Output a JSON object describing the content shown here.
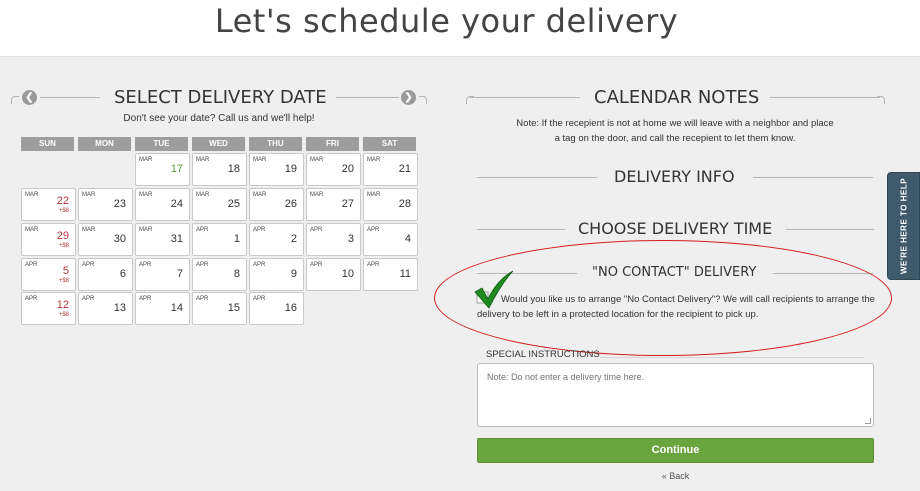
{
  "title": "Let's schedule your delivery",
  "left": {
    "heading": "SELECT DELIVERY DATE",
    "help": "Don't see your date? Call us and we'll help!",
    "prev_icon": "chevron-left-icon",
    "next_icon": "chevron-right-icon",
    "days_of_week": [
      "SUN",
      "MON",
      "TUE",
      "WED",
      "THU",
      "FRI",
      "SAT"
    ],
    "weeks": [
      [
        null,
        null,
        {
          "month": "MAR",
          "day": "17",
          "today": true
        },
        {
          "month": "MAR",
          "day": "18"
        },
        {
          "month": "MAR",
          "day": "19"
        },
        {
          "month": "MAR",
          "day": "20"
        },
        {
          "month": "MAR",
          "day": "21"
        }
      ],
      [
        {
          "month": "MAR",
          "day": "22",
          "fee": "+$8"
        },
        {
          "month": "MAR",
          "day": "23"
        },
        {
          "month": "MAR",
          "day": "24"
        },
        {
          "month": "MAR",
          "day": "25"
        },
        {
          "month": "MAR",
          "day": "26"
        },
        {
          "month": "MAR",
          "day": "27"
        },
        {
          "month": "MAR",
          "day": "28"
        }
      ],
      [
        {
          "month": "MAR",
          "day": "29",
          "fee": "+$8"
        },
        {
          "month": "MAR",
          "day": "30"
        },
        {
          "month": "MAR",
          "day": "31"
        },
        {
          "month": "APR",
          "day": "1"
        },
        {
          "month": "APR",
          "day": "2"
        },
        {
          "month": "APR",
          "day": "3"
        },
        {
          "month": "APR",
          "day": "4"
        }
      ],
      [
        {
          "month": "APR",
          "day": "5",
          "fee": "+$8"
        },
        {
          "month": "APR",
          "day": "6"
        },
        {
          "month": "APR",
          "day": "7"
        },
        {
          "month": "APR",
          "day": "8"
        },
        {
          "month": "APR",
          "day": "9"
        },
        {
          "month": "APR",
          "day": "10"
        },
        {
          "month": "APR",
          "day": "11"
        }
      ],
      [
        {
          "month": "APR",
          "day": "12",
          "fee": "+$8"
        },
        {
          "month": "APR",
          "day": "13"
        },
        {
          "month": "APR",
          "day": "14"
        },
        {
          "month": "APR",
          "day": "15"
        },
        {
          "month": "APR",
          "day": "16"
        },
        null,
        null
      ]
    ]
  },
  "right": {
    "calendar_notes_heading": "CALENDAR NOTES",
    "note_line1": "Note: If the recepient is not at home we will leave with a neighbor and place",
    "note_line2": "a tag on the door, and call the recepient to let them know.",
    "delivery_info_heading": "DELIVERY INFO",
    "choose_time_heading": "CHOOSE DELIVERY TIME",
    "no_contact_heading": "\"NO CONTACT\" DELIVERY",
    "no_contact_text": "Would you like us to arrange \"No Contact Delivery\"? We will call recipients to arrange the delivery to be left in a protected location for the recipient to pick up.",
    "no_contact_checked": true,
    "special_instructions_label": "SPECIAL INSTRUCTIONS",
    "special_instructions_placeholder": "Note: Do not enter a delivery time here.",
    "special_instructions_value": "",
    "continue_label": "Continue",
    "back_label": "« Back"
  },
  "help_tab": "WE'RE HERE TO HELP",
  "colors": {
    "accent_green": "#6aa43f",
    "surcharge_red": "#b6353c",
    "annotation_red": "#d11c1c",
    "help_tab": "#3f5b6b"
  }
}
